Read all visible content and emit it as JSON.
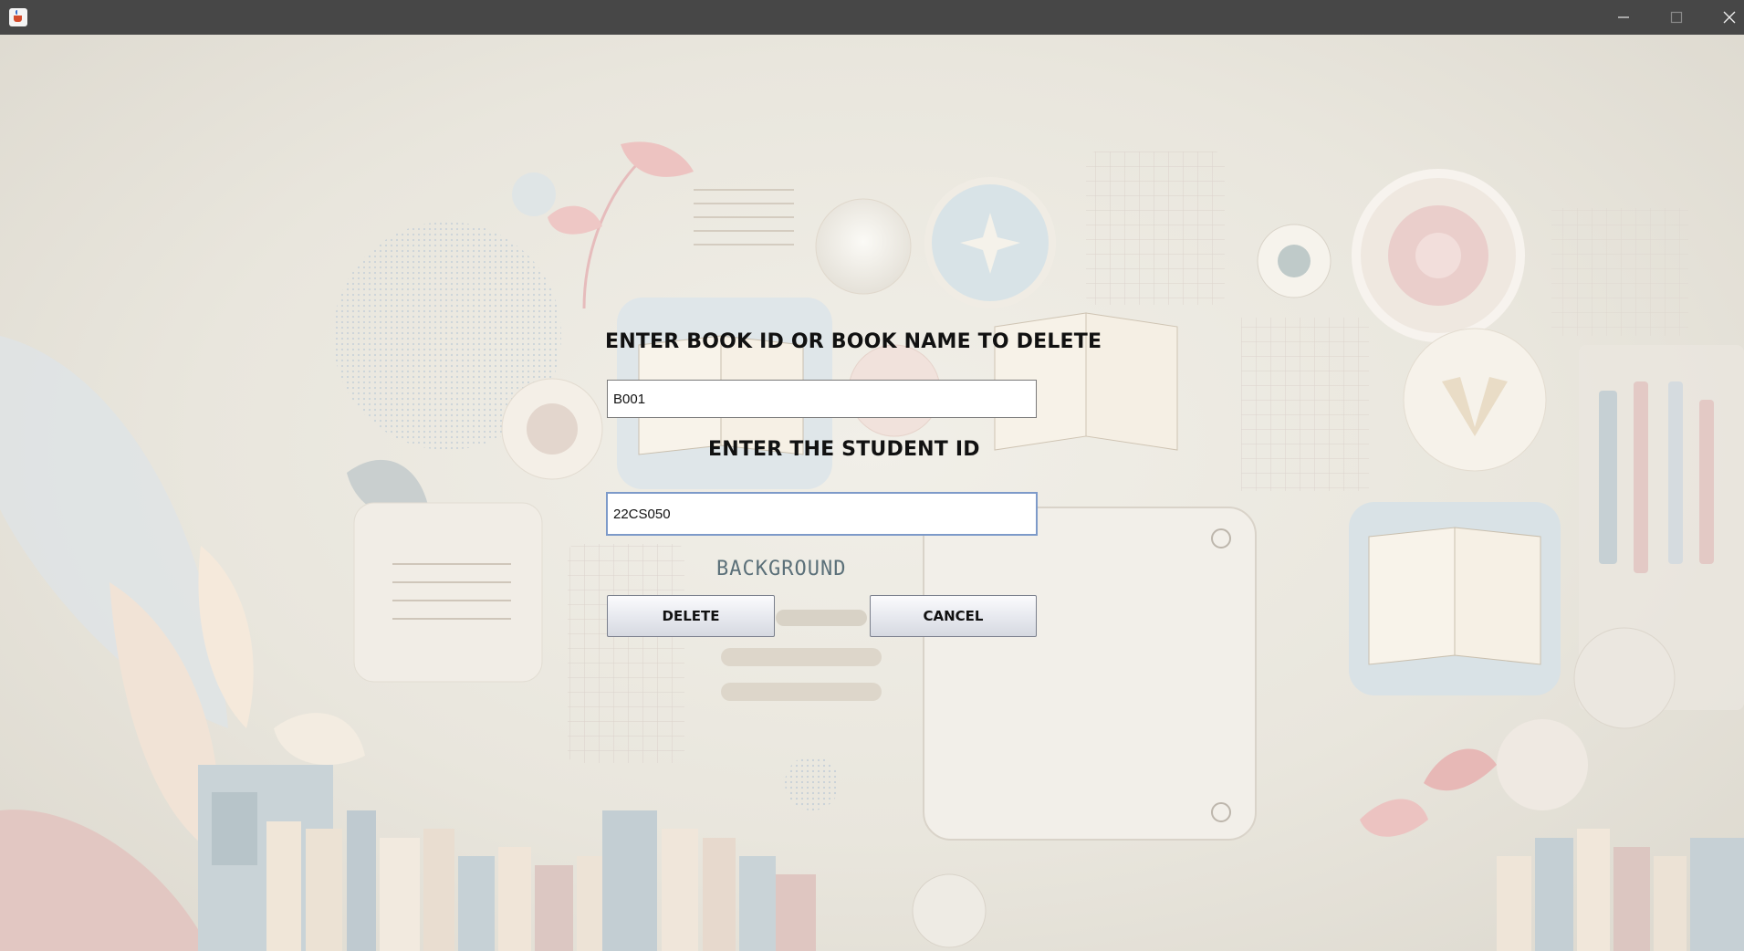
{
  "window": {
    "title": "",
    "icon": "java-cup-icon",
    "controls": [
      "minimize-icon",
      "maximize-icon",
      "close-icon"
    ]
  },
  "form": {
    "book_label": "ENTER BOOK ID OR BOOK NAME TO DELETE",
    "book_value": "B001",
    "student_label": "ENTER THE STUDENT ID",
    "student_value": "22CS050",
    "delete_label": "DELETE",
    "cancel_label": "CANCEL"
  },
  "background": {
    "caption": "BACKGROUND"
  },
  "colors": {
    "titlebar": "#474747",
    "focus_border": "#7d9ac9"
  }
}
